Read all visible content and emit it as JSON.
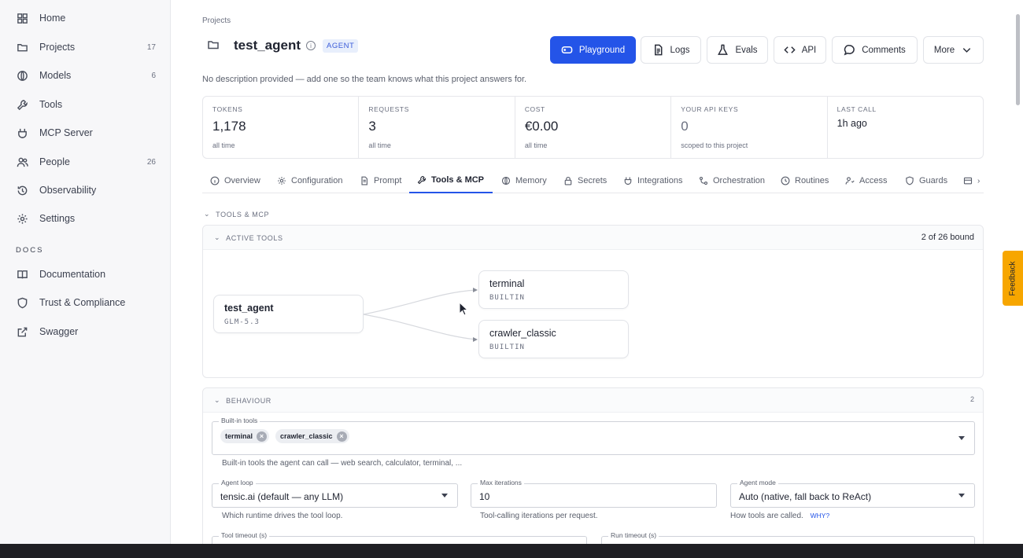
{
  "sidebar": {
    "items": [
      {
        "label": "Home",
        "icon": "grid-icon",
        "count": ""
      },
      {
        "label": "Projects",
        "icon": "folder-icon",
        "count": "17"
      },
      {
        "label": "Models",
        "icon": "globe-icon",
        "count": "6"
      },
      {
        "label": "Tools",
        "icon": "wrench-icon",
        "count": ""
      },
      {
        "label": "MCP Server",
        "icon": "plug-icon",
        "count": ""
      },
      {
        "label": "People",
        "icon": "users-icon",
        "count": "26"
      },
      {
        "label": "Observability",
        "icon": "history-icon",
        "count": ""
      },
      {
        "label": "Settings",
        "icon": "gear-icon",
        "count": ""
      }
    ],
    "docs_label": "DOCS",
    "docs_items": [
      {
        "label": "Documentation",
        "icon": "book-icon"
      },
      {
        "label": "Trust & Compliance",
        "icon": "shield-icon"
      },
      {
        "label": "Swagger",
        "icon": "external-link-icon"
      }
    ]
  },
  "header": {
    "breadcrumb": "Projects",
    "title": "test_agent",
    "badge": "AGENT",
    "description": "No description provided — add one so the team knows what this project answers for.",
    "buttons": {
      "playground": "Playground",
      "logs": "Logs",
      "evals": "Evals",
      "api": "API",
      "comments": "Comments",
      "more": "More"
    }
  },
  "stats": [
    {
      "label": "TOKENS",
      "value": "1,178",
      "sub": "all time"
    },
    {
      "label": "REQUESTS",
      "value": "3",
      "sub": "all time"
    },
    {
      "label": "COST",
      "value": "€0.00",
      "sub": "all time"
    },
    {
      "label": "YOUR API KEYS",
      "value": "0",
      "sub": "scoped to this project"
    },
    {
      "label": "LAST CALL",
      "value": "1h ago",
      "sub": ""
    }
  ],
  "tabs": [
    {
      "label": "Overview",
      "icon": "info-icon"
    },
    {
      "label": "Configuration",
      "icon": "gear-icon"
    },
    {
      "label": "Prompt",
      "icon": "document-icon"
    },
    {
      "label": "Tools & MCP",
      "icon": "wrench-icon"
    },
    {
      "label": "Memory",
      "icon": "globe-icon"
    },
    {
      "label": "Secrets",
      "icon": "lock-icon"
    },
    {
      "label": "Integrations",
      "icon": "plug-icon"
    },
    {
      "label": "Orchestration",
      "icon": "flow-icon"
    },
    {
      "label": "Routines",
      "icon": "clock-icon"
    },
    {
      "label": "Access",
      "icon": "user-access-icon"
    },
    {
      "label": "Guards",
      "icon": "shield-icon"
    }
  ],
  "active_tab": "Tools & MCP",
  "tools_section": {
    "label": "TOOLS & MCP",
    "active_tools": {
      "label": "ACTIVE TOOLS",
      "bound": "2 of 26 bound",
      "agent_node": {
        "title": "test_agent",
        "subtitle": "GLM-5.3"
      },
      "tool_nodes": [
        {
          "title": "terminal",
          "subtitle": "BUILTIN"
        },
        {
          "title": "crawler_classic",
          "subtitle": "BUILTIN"
        }
      ]
    },
    "behaviour": {
      "label": "BEHAVIOUR",
      "count": "2",
      "builtin_tools": {
        "label": "Built-in tools",
        "chips": [
          "terminal",
          "crawler_classic"
        ],
        "help": "Built-in tools the agent can call — web search, calculator, terminal, ..."
      },
      "agent_loop": {
        "label": "Agent loop",
        "value": "tensic.ai (default — any LLM)",
        "help": "Which runtime drives the tool loop."
      },
      "max_iterations": {
        "label": "Max iterations",
        "value": "10",
        "help": "Tool-calling iterations per request."
      },
      "agent_mode": {
        "label": "Agent mode",
        "value": "Auto (native, fall back to ReAct)",
        "help": "How tools are called.",
        "why": "WHY?"
      },
      "tool_timeout": {
        "label": "Tool timeout (s)"
      },
      "run_timeout": {
        "label": "Run timeout (s)"
      }
    }
  },
  "feedback": "Feedback",
  "colors": {
    "accent": "#2454e8",
    "feedback": "#f7a600",
    "badge_bg": "#e8effc"
  }
}
